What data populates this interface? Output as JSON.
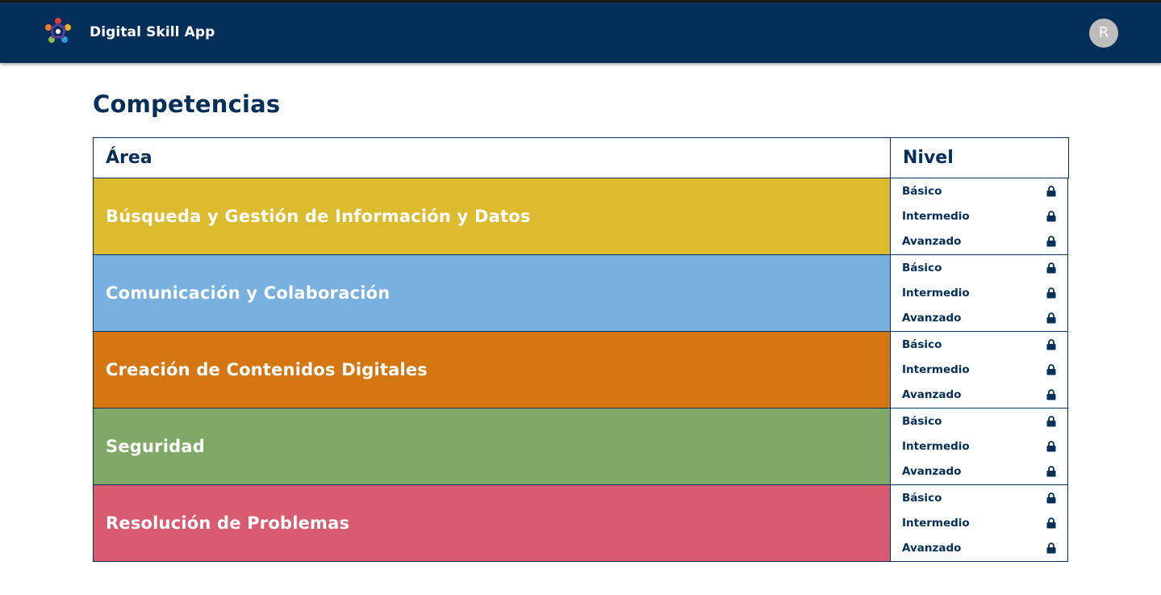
{
  "app": {
    "title": "Digital Skill App",
    "avatar_initial": "R"
  },
  "page": {
    "title": "Competencias"
  },
  "table": {
    "headers": {
      "area": "Área",
      "nivel": "Nivel"
    },
    "rows": [
      {
        "area": "Búsqueda y Gestión de Información y Datos",
        "color": "#dcbb2f",
        "levels": [
          {
            "label": "Básico",
            "icon": "lock-icon"
          },
          {
            "label": "Intermedio",
            "icon": "lock-icon"
          },
          {
            "label": "Avanzado",
            "icon": "lock-icon"
          }
        ]
      },
      {
        "area": "Comunicación y Colaboración",
        "color": "#78b0e0",
        "levels": [
          {
            "label": "Básico",
            "icon": "lock-icon"
          },
          {
            "label": "Intermedio",
            "icon": "lock-icon"
          },
          {
            "label": "Avanzado",
            "icon": "lock-icon"
          }
        ]
      },
      {
        "area": "Creación de Contenidos Digitales",
        "color": "#d47713",
        "levels": [
          {
            "label": "Básico",
            "icon": "lock-icon"
          },
          {
            "label": "Intermedio",
            "icon": "lock-icon"
          },
          {
            "label": "Avanzado",
            "icon": "lock-icon"
          }
        ]
      },
      {
        "area": "Seguridad",
        "color": "#80a867",
        "levels": [
          {
            "label": "Básico",
            "icon": "lock-icon"
          },
          {
            "label": "Intermedio",
            "icon": "lock-icon"
          },
          {
            "label": "Avanzado",
            "icon": "lock-icon"
          }
        ]
      },
      {
        "area": "Resolución de Problemas",
        "color": "#d95b72",
        "levels": [
          {
            "label": "Básico",
            "icon": "lock-icon"
          },
          {
            "label": "Intermedio",
            "icon": "lock-icon"
          },
          {
            "label": "Avanzado",
            "icon": "lock-icon"
          }
        ]
      }
    ]
  },
  "colors": {
    "navy": "#032f59",
    "avatar_bg": "#bdbdbd"
  }
}
